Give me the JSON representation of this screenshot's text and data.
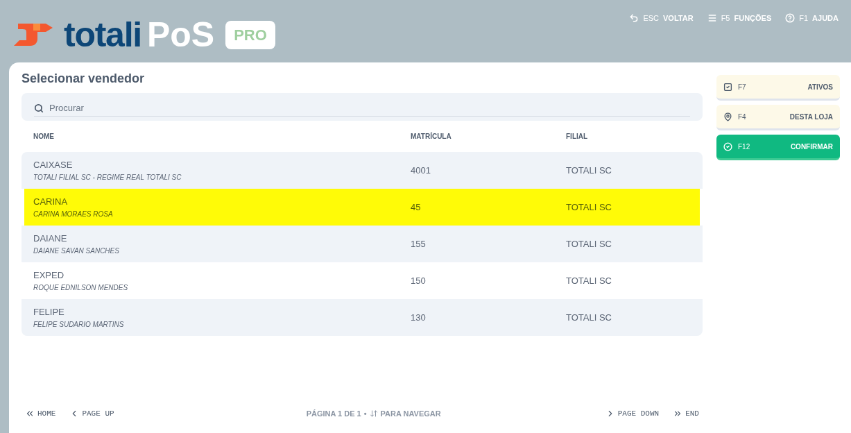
{
  "logo": {
    "brand": "totali",
    "product": "PoS",
    "edition": "PRO"
  },
  "top_actions": [
    {
      "kind": "back",
      "key": "ESC",
      "label": "VOLTAR"
    },
    {
      "kind": "menu",
      "key": "F5",
      "label": "FUNÇÕES"
    },
    {
      "kind": "help",
      "key": "F1",
      "label": "AJUDA"
    }
  ],
  "title": "Selecionar vendedor",
  "search": {
    "placeholder": "Procurar"
  },
  "table": {
    "columns": [
      "NOME",
      "MATRÍCULA",
      "FILIAL"
    ],
    "rows": [
      {
        "name": "CAIXASE",
        "full_name": "TOTALI FILIAL SC - REGIME REAL TOTALI SC",
        "id": "4001",
        "branch": "TOTALI SC",
        "selected": false
      },
      {
        "name": "CARINA",
        "full_name": "CARINA MORAES ROSA",
        "id": "45",
        "branch": "TOTALI SC",
        "selected": true
      },
      {
        "name": "DAIANE",
        "full_name": "DAIANE SAVAN SANCHES",
        "id": "155",
        "branch": "TOTALI SC",
        "selected": false
      },
      {
        "name": "EXPED",
        "full_name": "ROQUE EDNILSON MENDES",
        "id": "150",
        "branch": "TOTALI SC",
        "selected": false
      },
      {
        "name": "FELIPE",
        "full_name": "FELIPE SUDARIO MARTINS",
        "id": "130",
        "branch": "TOTALI SC",
        "selected": false
      }
    ]
  },
  "pager": {
    "first": "HOME",
    "prev": "PAGE UP",
    "status": "PÁGINA 1 DE 1",
    "separator": "•",
    "hint": "PARA NAVEGAR",
    "next": "PAGE DOWN",
    "last": "END"
  },
  "side_buttons": [
    {
      "kind": "check",
      "key": "F7",
      "label": "ATIVOS",
      "primary": false
    },
    {
      "kind": "pin",
      "key": "F4",
      "label": "DESTA LOJA",
      "primary": false
    },
    {
      "kind": "confirm",
      "key": "F12",
      "label": "CONFIRMAR",
      "primary": true
    }
  ]
}
